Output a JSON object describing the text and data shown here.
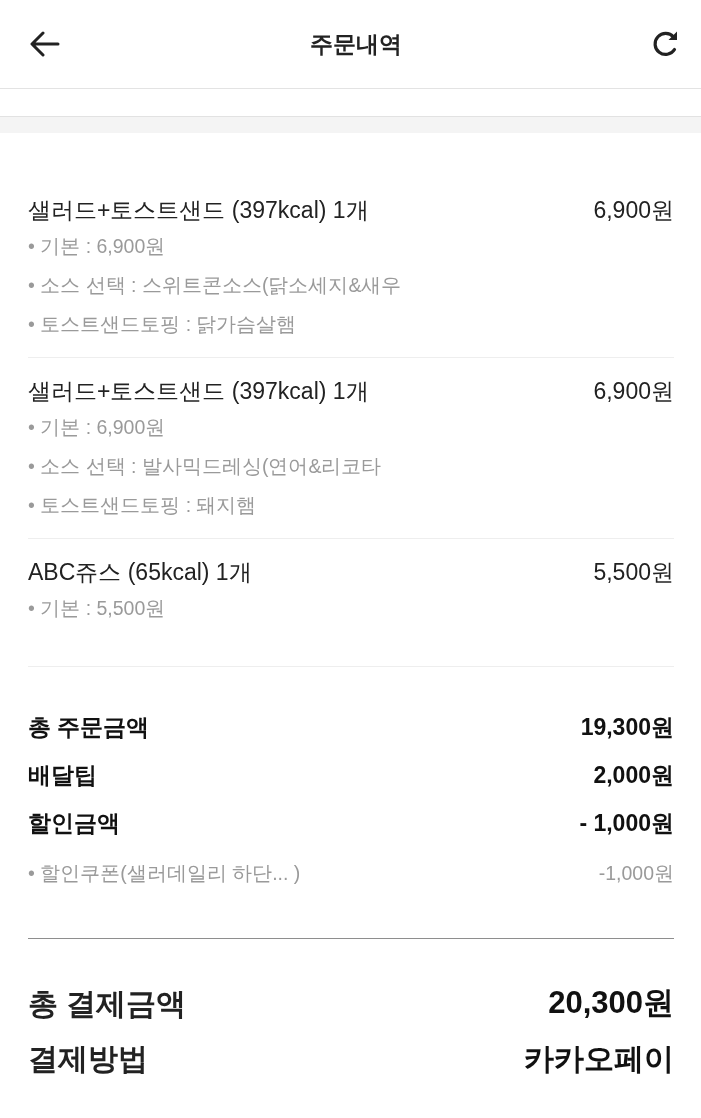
{
  "header": {
    "title": "주문내역"
  },
  "items": [
    {
      "name": "샐러드+토스트샌드 (397kcal) 1개",
      "price": "6,900원",
      "options": [
        "• 기본 : 6,900원",
        "• 소스 선택 : 스위트콘소스(닭소세지&새우",
        "• 토스트샌드토핑 : 닭가슴살햄"
      ]
    },
    {
      "name": "샐러드+토스트샌드 (397kcal) 1개",
      "price": "6,900원",
      "options": [
        "• 기본 : 6,900원",
        "• 소스 선택 : 발사믹드레싱(연어&리코타",
        "• 토스트샌드토핑 : 돼지햄"
      ]
    },
    {
      "name": "ABC쥬스 (65kcal) 1개",
      "price": "5,500원",
      "options": [
        "• 기본 : 5,500원"
      ]
    }
  ],
  "summary": [
    {
      "kind": "main",
      "label": "총 주문금액",
      "value": "19,300원"
    },
    {
      "kind": "main",
      "label": "배달팁",
      "value": "2,000원"
    },
    {
      "kind": "main",
      "label": "할인금액",
      "value": "- 1,000원"
    },
    {
      "kind": "sub",
      "label": "• 할인쿠폰(샐러데일리 하단... )",
      "value": "-1,000원"
    }
  ],
  "payment": [
    {
      "kind": "total",
      "label": "총 결제금액",
      "value": "20,300원"
    },
    {
      "kind": "method",
      "label": "결제방법",
      "value": "카카오페이"
    }
  ]
}
